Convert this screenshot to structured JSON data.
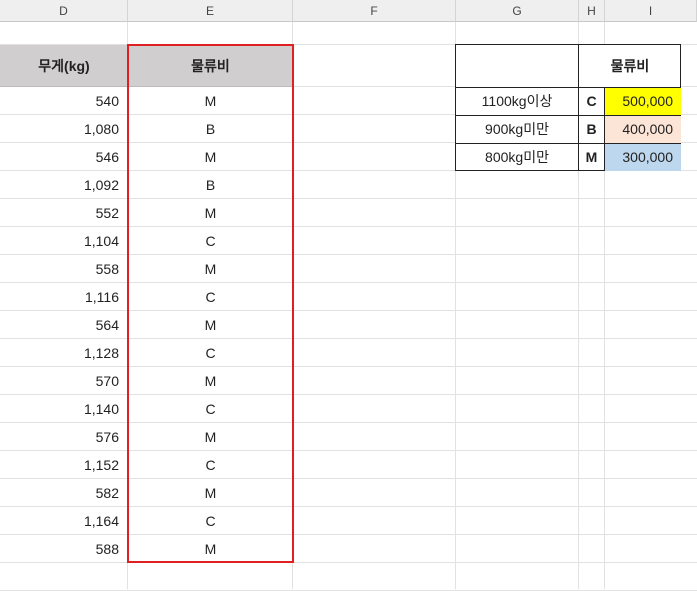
{
  "columns": [
    "D",
    "E",
    "F",
    "G",
    "H",
    "I"
  ],
  "left_table": {
    "headers": {
      "weight": "무게(kg)",
      "cost": "물류비"
    },
    "rows": [
      {
        "weight": "540",
        "grade": "M"
      },
      {
        "weight": "1,080",
        "grade": "B"
      },
      {
        "weight": "546",
        "grade": "M"
      },
      {
        "weight": "1,092",
        "grade": "B"
      },
      {
        "weight": "552",
        "grade": "M"
      },
      {
        "weight": "1,104",
        "grade": "C"
      },
      {
        "weight": "558",
        "grade": "M"
      },
      {
        "weight": "1,116",
        "grade": "C"
      },
      {
        "weight": "564",
        "grade": "M"
      },
      {
        "weight": "1,128",
        "grade": "C"
      },
      {
        "weight": "570",
        "grade": "M"
      },
      {
        "weight": "1,140",
        "grade": "C"
      },
      {
        "weight": "576",
        "grade": "M"
      },
      {
        "weight": "1,152",
        "grade": "C"
      },
      {
        "weight": "582",
        "grade": "M"
      },
      {
        "weight": "1,164",
        "grade": "C"
      },
      {
        "weight": "588",
        "grade": "M"
      }
    ]
  },
  "right_table": {
    "header": "물류비",
    "rows": [
      {
        "condition": "1100kg이상",
        "grade": "C",
        "cost": "500,000",
        "color": "#ffff00"
      },
      {
        "condition": "900kg미만",
        "grade": "B",
        "cost": "400,000",
        "color": "#fce4d6"
      },
      {
        "condition": "800kg미만",
        "grade": "M",
        "cost": "300,000",
        "color": "#bdd7ee"
      }
    ]
  },
  "colors": {
    "selection_border": "#e02020",
    "header_fill": "#d0cece"
  }
}
